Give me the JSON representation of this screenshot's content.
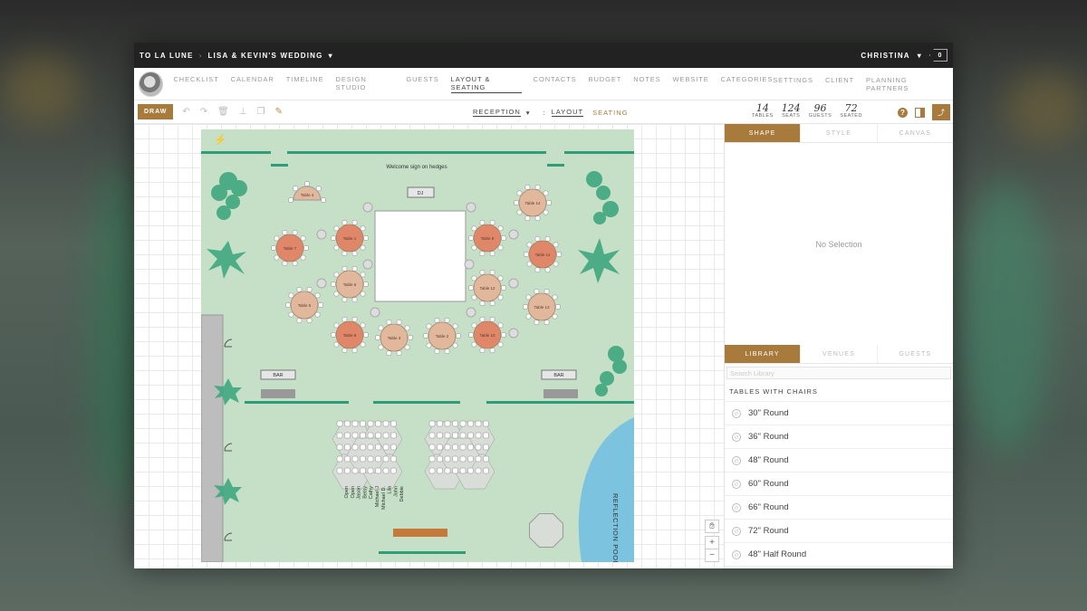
{
  "header": {
    "brand": "TO LA LUNE",
    "event": "LISA & KEVIN'S WEDDING",
    "user": "CHRISTINA",
    "notifications": "0"
  },
  "nav": {
    "items": [
      "CHECKLIST",
      "CALENDAR",
      "TIMELINE",
      "DESIGN STUDIO",
      "GUESTS",
      "LAYOUT & SEATING",
      "CONTACTS",
      "BUDGET",
      "NOTES",
      "WEBSITE",
      "CATEGORIES"
    ],
    "active": "LAYOUT & SEATING",
    "right_items": [
      "SETTINGS",
      "CLIENT",
      "PLANNING PARTNERS"
    ]
  },
  "toolbar": {
    "draw_label": "DRAW",
    "room": "RECEPTION",
    "separator": ":",
    "layout_label": "LAYOUT",
    "seating_label": "SEATING",
    "help": "?"
  },
  "stats": [
    {
      "value": "14",
      "label": "TABLES"
    },
    {
      "value": "124",
      "label": "SEATS"
    },
    {
      "value": "96",
      "label": "GUESTS"
    },
    {
      "value": "72",
      "label": "SEATED"
    }
  ],
  "floor": {
    "sign": "Welcome sign on hedges",
    "dj": "DJ",
    "bar_left": "BAR",
    "bar_right": "BAR",
    "pool": "REFLECTION POOL",
    "tables": [
      {
        "label": "Table 1"
      },
      {
        "label": "Table 2"
      },
      {
        "label": "Table 3"
      },
      {
        "label": "Table 4"
      },
      {
        "label": "Table 5"
      },
      {
        "label": "Table 6"
      },
      {
        "label": "Table 7"
      },
      {
        "label": "Table 8"
      },
      {
        "label": "Table 9"
      },
      {
        "label": "Table 10"
      },
      {
        "label": "Table 11"
      },
      {
        "label": "Table 12"
      },
      {
        "label": "Table 13"
      },
      {
        "label": "Table 14"
      }
    ],
    "ceremony_names": [
      "Open",
      "Open",
      "Jason",
      "Betsy",
      "Cathy",
      "Michael J",
      "Michael D.",
      "Lila",
      "John",
      "Debbie"
    ]
  },
  "side": {
    "top_tabs": [
      "SHAPE",
      "STYLE",
      "CANVAS"
    ],
    "no_selection": "No Selection",
    "lib_tabs": [
      "LIBRARY",
      "VENUES",
      "GUESTS"
    ],
    "search_placeholder": "Search Library",
    "section": "TABLES WITH CHAIRS",
    "items": [
      "30\" Round",
      "36\" Round",
      "48\" Round",
      "60\" Round",
      "66\" Round",
      "72\" Round",
      "48\" Half Round"
    ]
  },
  "zoom": {
    "plus": "+",
    "minus": "−"
  },
  "colors": {
    "accent": "#a87b3d",
    "floor": "#c5e0c6",
    "hedge": "#2e9e79",
    "table_orange": "#e0876a",
    "table_tan": "#e2b89d",
    "pool": "#7cc3e0"
  }
}
